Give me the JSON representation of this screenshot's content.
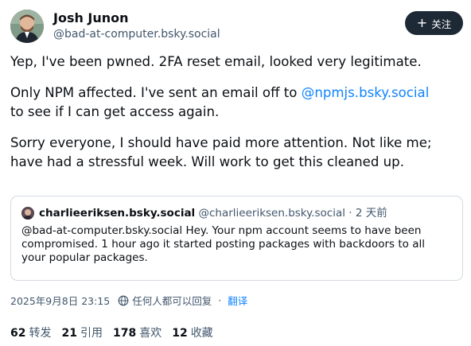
{
  "author": {
    "name": "Josh Junon",
    "handle": "@bad-at-computer.bsky.social"
  },
  "follow_button": {
    "label": "关注",
    "icon": "plus-icon"
  },
  "post": {
    "lines_1": [
      "Yep, I've been pwned. 2FA reset email, looked very legitimate."
    ],
    "line_2a": "Only NPM affected. I've sent an email off to ",
    "mention": "@npmjs.bsky.social",
    "line_2b": "to see if I can get access again.",
    "lines_3": [
      "Sorry everyone, I should have paid more attention. Not like me;",
      "have had a stressful week. Will work to get this cleaned up."
    ]
  },
  "quote": {
    "name": "charlieeriksen.bsky.social",
    "handle": "@charlieeriksen.bsky.social",
    "time": "· 2 天前",
    "lines": [
      "@bad-at-computer.bsky.social Hey. Your npm account seems to have been",
      "compromised. 1 hour ago it started posting packages with backdoors to all",
      "your popular packages."
    ]
  },
  "meta": {
    "timestamp": "2025年9月8日 23:15",
    "reply_setting": "任何人都可以回复",
    "separator": "·",
    "translate": "翻译"
  },
  "stats": [
    {
      "count": "62",
      "label": "转发"
    },
    {
      "count": "21",
      "label": "引用"
    },
    {
      "count": "178",
      "label": "喜欢"
    },
    {
      "count": "12",
      "label": "收藏"
    }
  ],
  "colors": {
    "link": "#1083fe",
    "muted": "#42576c",
    "button_bg": "#1e2936",
    "border": "#d4dbe2"
  }
}
